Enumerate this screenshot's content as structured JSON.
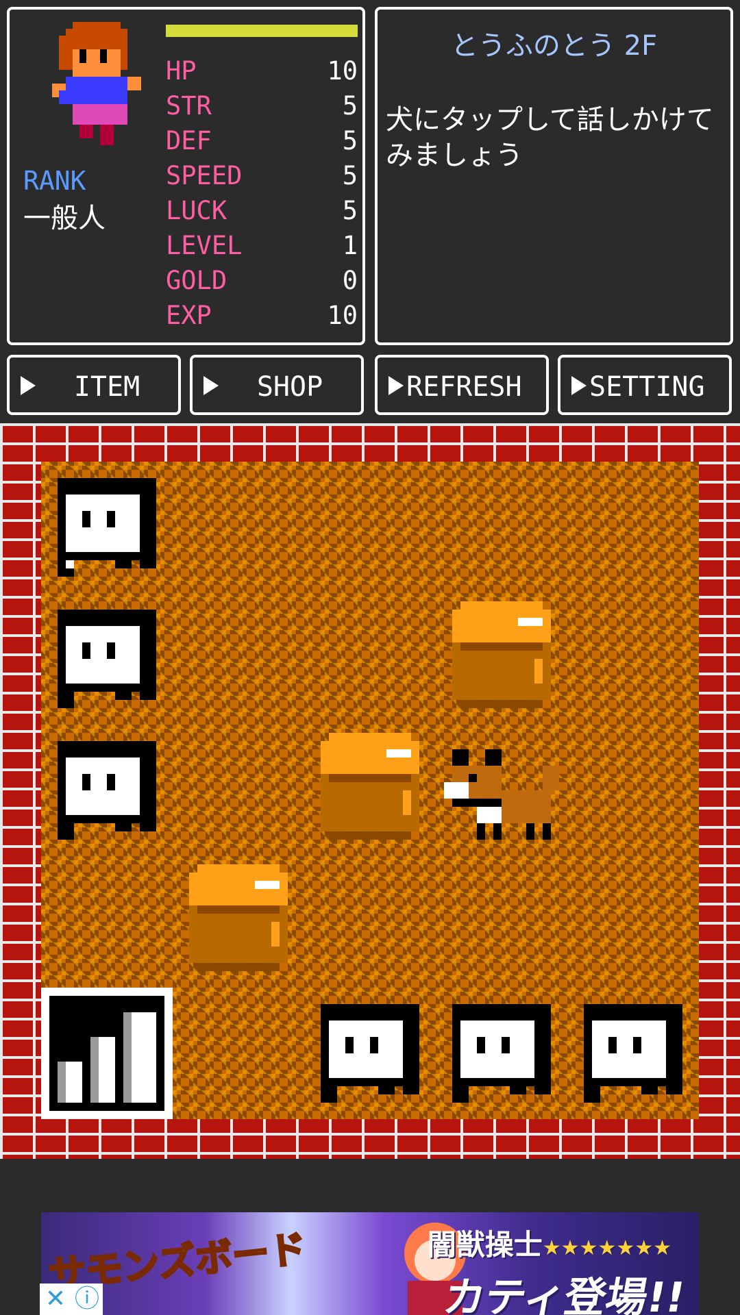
{
  "status": {
    "rank_label": "RANK",
    "rank_value": "一般人",
    "stats": [
      {
        "name": "HP",
        "value": "10"
      },
      {
        "name": "STR",
        "value": "5"
      },
      {
        "name": "DEF",
        "value": "5"
      },
      {
        "name": "SPEED",
        "value": "5"
      },
      {
        "name": "LUCK",
        "value": "5"
      },
      {
        "name": "LEVEL",
        "value": "1"
      },
      {
        "name": "GOLD",
        "value": "0"
      },
      {
        "name": "EXP",
        "value": "10"
      }
    ],
    "hp_fill": 1.0
  },
  "message": {
    "floor_title": "とうふのとう 2F",
    "text": "犬にタップして話しかけてみましょう"
  },
  "menu": {
    "item": "ITEM",
    "shop": "SHOP",
    "refresh": "REFRESH",
    "setting": "SETTING"
  },
  "ad": {
    "logo": "サモンズボード",
    "headline": "闇獣操士",
    "stars": "★★★★★★★",
    "sub": "カティ登場!!",
    "close": "✕",
    "info": "ⓘ"
  },
  "colors": {
    "stat_name": "#ff5fa2",
    "rank_label": "#5b9bff",
    "floor_title": "#a6c6ff",
    "hp_bar": "#d4dc3b",
    "brick": "#b5150e",
    "floor_orange": "#c96c00",
    "floor_dark": "#8b4a00"
  }
}
